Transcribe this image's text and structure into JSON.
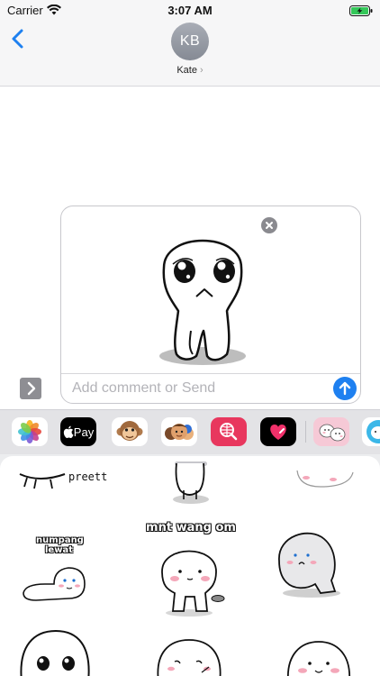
{
  "status_bar": {
    "carrier": "Carrier",
    "time": "3:07 AM"
  },
  "header": {
    "avatar_initials": "KB",
    "contact_name": "Kate",
    "contact_chevron": "›"
  },
  "compose": {
    "placeholder": "Add comment or Send",
    "value": ""
  },
  "app_strip": {
    "apps": [
      {
        "name": "Photos",
        "icon": "photos-icon"
      },
      {
        "name": "Apple Pay",
        "label": "Pay",
        "icon": "apple-pay-icon"
      },
      {
        "name": "Animoji",
        "icon": "monkey-icon"
      },
      {
        "name": "Memoji",
        "icon": "memoji-icon"
      },
      {
        "name": "#images",
        "icon": "globe-search-icon"
      },
      {
        "name": "Digital Touch",
        "icon": "heart-icon"
      },
      {
        "name": "Sticker pack",
        "icon": "sticker-pack-icon"
      }
    ]
  },
  "stickers": {
    "captions": {
      "preett": "preett",
      "numpang_line1": "numpang",
      "numpang_line2": "lewat",
      "mnt_wang_om": "mnt wang om"
    }
  },
  "colors": {
    "accent": "#1e80f0",
    "header_bg": "#f6f6f7",
    "strip_bg": "#e3e3e6"
  }
}
